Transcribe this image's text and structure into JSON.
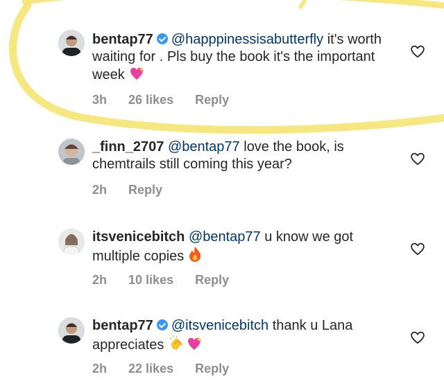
{
  "comments": [
    {
      "username": "bentap77",
      "verified": true,
      "mention": "@happpinessisabutterfly",
      "text": " it's worth waiting for . Pls buy the book it's the important week",
      "time": "3h",
      "likes": "26 likes",
      "reply": "Reply",
      "emoji": "sparkling-heart"
    },
    {
      "username": "_finn_2707",
      "verified": false,
      "mention": "@bentap77",
      "text": " love the book, is chemtrails still coming this year?",
      "time": "2h",
      "likes": "",
      "reply": "Reply"
    },
    {
      "username": "itsvenicebitch",
      "verified": false,
      "mention": "@bentap77",
      "text": " u know we got multiple copies",
      "time": "2h",
      "likes": "10 likes",
      "reply": "Reply",
      "emoji": "fire"
    },
    {
      "username": "bentap77",
      "verified": true,
      "mention": "@itsvenicebitch",
      "text": " thank u Lana appreciates",
      "time": "2h",
      "likes": "22 likes",
      "reply": "Reply",
      "emoji": "clapping-hands sparkling-heart"
    }
  ],
  "colors": {
    "highlight": "#f5e36b",
    "mention": "#00376b",
    "meta": "#8e8e8e",
    "verified": "#3897f0"
  }
}
